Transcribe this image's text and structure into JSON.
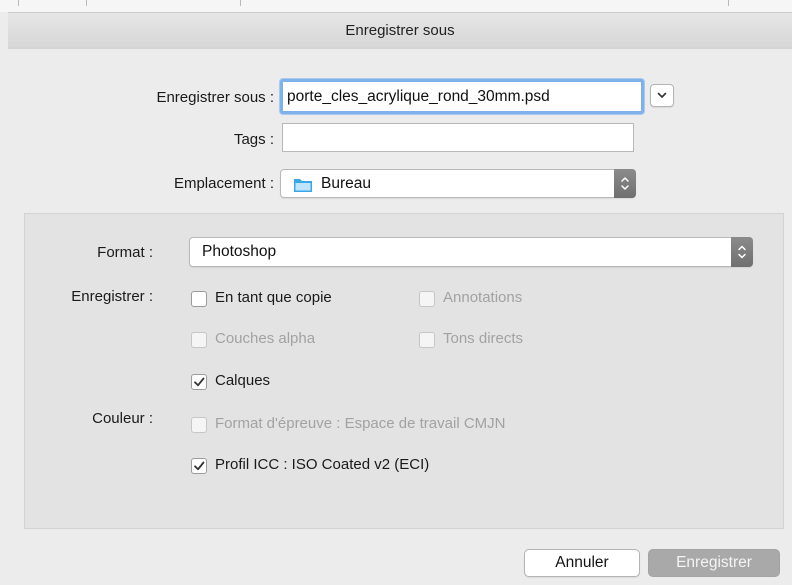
{
  "window": {
    "title": "Enregistrer sous"
  },
  "fields": {
    "save_as_label": "Enregistrer sous :",
    "save_as_value": "porte_cles_acrylique_rond_30mm.psd",
    "tags_label": "Tags :",
    "tags_value": "",
    "location_label": "Emplacement :",
    "location_value": "Bureau"
  },
  "options": {
    "format_label": "Format :",
    "format_value": "Photoshop",
    "save_label": "Enregistrer :",
    "color_label": "Couleur :",
    "checkboxes": [
      {
        "label": "En tant que copie",
        "checked": false,
        "enabled": true
      },
      {
        "label": "Annotations",
        "checked": false,
        "enabled": false
      },
      {
        "label": "Couches alpha",
        "checked": false,
        "enabled": false
      },
      {
        "label": "Tons directs",
        "checked": false,
        "enabled": false
      },
      {
        "label": "Calques",
        "checked": true,
        "enabled": true
      },
      {
        "label": "Format d'épreuve : Espace de travail CMJN",
        "checked": false,
        "enabled": false
      },
      {
        "label": "Profil ICC : ISO Coated v2 (ECI)",
        "checked": true,
        "enabled": true
      }
    ]
  },
  "buttons": {
    "cancel": "Annuler",
    "save": "Enregistrer"
  },
  "colors": {
    "focus_ring": "#7fb2ea",
    "folder_icon": "#39a7e8",
    "disabled_button": "#a9a9a9"
  },
  "icons": [
    "chevron-down-icon",
    "folder-icon",
    "stepper-icon",
    "checkmark-icon"
  ]
}
